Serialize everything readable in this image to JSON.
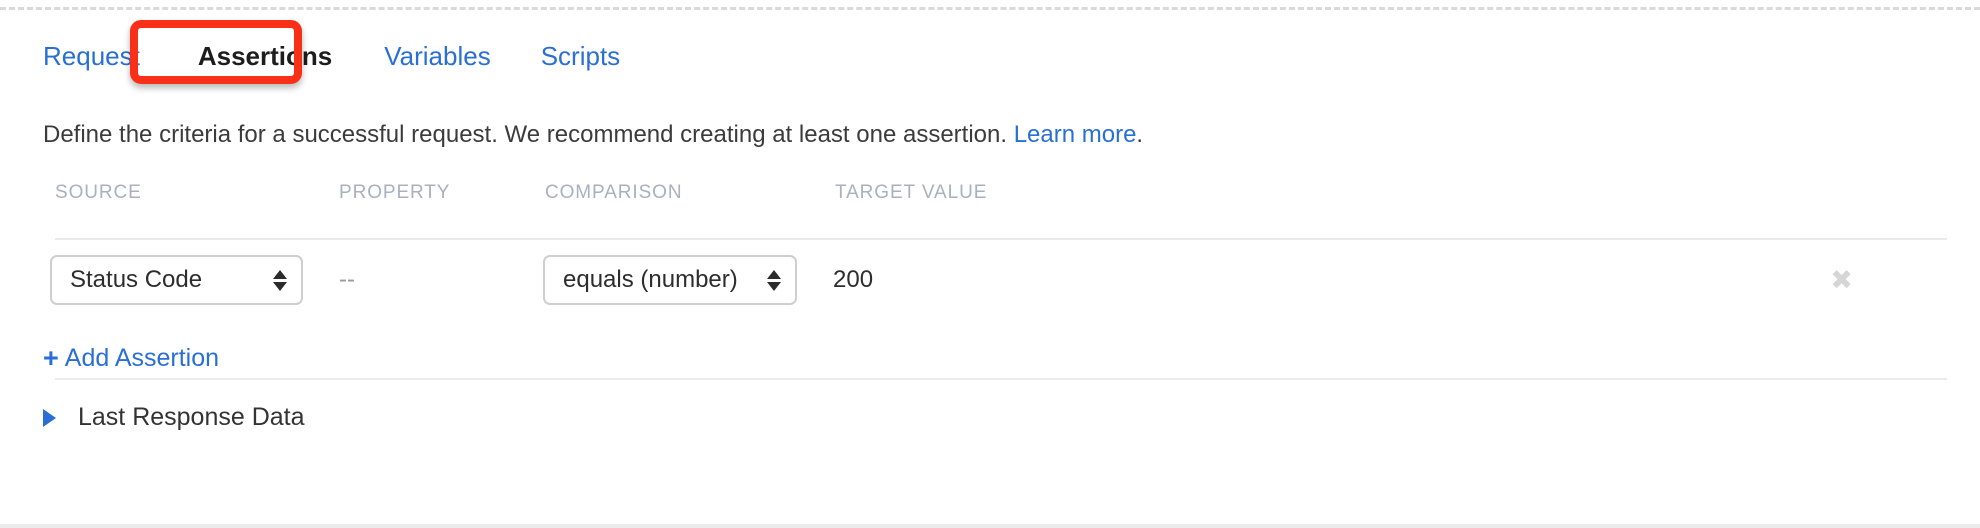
{
  "tabs": [
    {
      "label": "Request",
      "active": false
    },
    {
      "label": "Assertions",
      "active": true
    },
    {
      "label": "Variables",
      "active": false
    },
    {
      "label": "Scripts",
      "active": false
    }
  ],
  "description": {
    "lead": "Define the criteria for a successful request. We recommend creating at least one assertion. ",
    "link_text": "Learn more",
    "trail": "."
  },
  "table": {
    "headers": {
      "source": "SOURCE",
      "property": "PROPERTY",
      "comparison": "COMPARISON",
      "target_value": "TARGET VALUE"
    },
    "rows": [
      {
        "source": "Status Code",
        "property": "--",
        "comparison": "equals (number)",
        "target_value": "200",
        "delete_glyph": "✖"
      }
    ]
  },
  "actions": {
    "add_assertion_plus": "+",
    "add_assertion_label": "Add Assertion"
  },
  "last_response": {
    "label": "Last Response Data",
    "expanded": false
  },
  "colors": {
    "link": "#2a6fd6",
    "annotation": "#fa2f18",
    "header_text": "#a9b1bc",
    "body_text": "#3b3b3b"
  }
}
